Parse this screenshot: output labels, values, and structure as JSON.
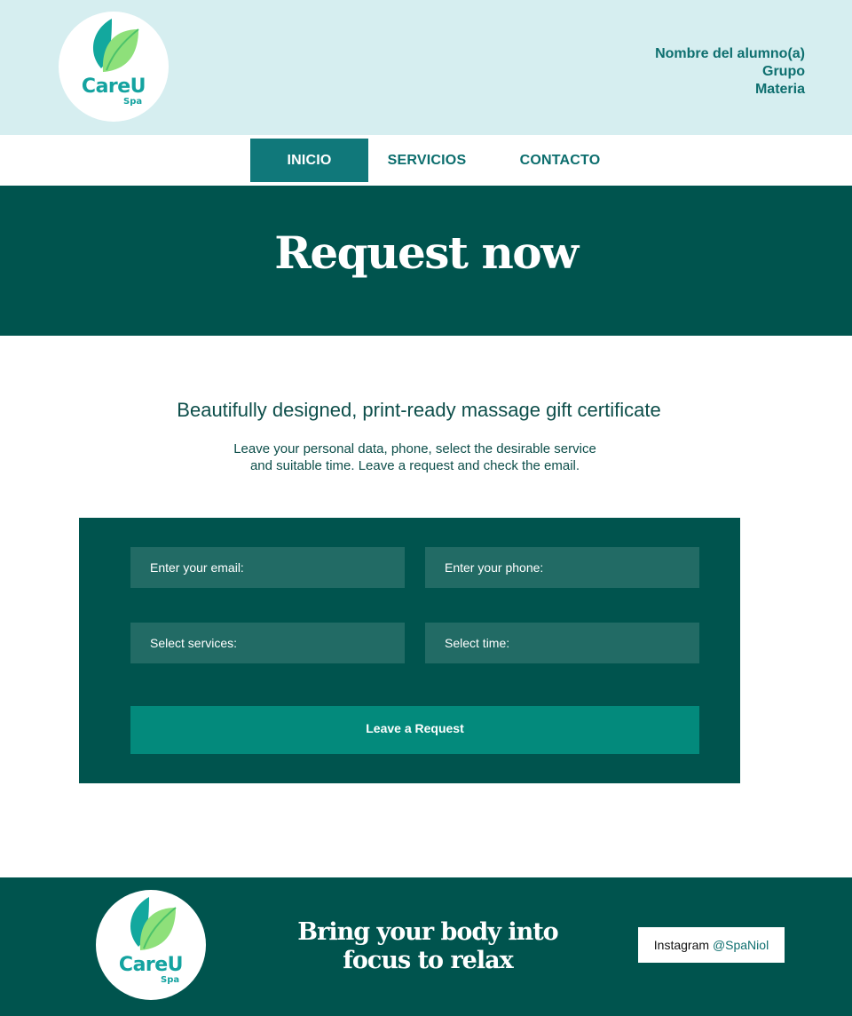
{
  "logo": {
    "text": "CareU",
    "sub": "Spa",
    "icon": "leaf-icon"
  },
  "student": {
    "name": "Nombre del alumno(a)",
    "group": "Grupo",
    "subject": "Materia"
  },
  "nav": {
    "items": [
      {
        "label": "INICIO",
        "active": true
      },
      {
        "label": "SERVICIOS",
        "active": false
      },
      {
        "label": "CONTACTO",
        "active": false
      }
    ]
  },
  "hero": {
    "title": "Request now"
  },
  "intro": {
    "subtitle": "Beautifully designed, print-ready massage gift certificate",
    "line1": "Leave your personal data, phone, select the desirable service",
    "line2": "and suitable time. Leave a request and check the email."
  },
  "form": {
    "email_placeholder": "Enter your email:",
    "phone_placeholder": "Enter your phone:",
    "services_placeholder": "Select services:",
    "time_placeholder": "Select time:",
    "submit_label": "Leave a Request"
  },
  "footer": {
    "tagline_line1": "Bring your body into",
    "tagline_line2": "focus to relax",
    "instagram_label": "Instagram",
    "instagram_handle": "@SpaNiol"
  },
  "colors": {
    "dark_teal": "#00544e",
    "nav_active": "#10787a",
    "header_bg": "#d6eef0",
    "button": "#038a7c",
    "field": "#226b65"
  }
}
